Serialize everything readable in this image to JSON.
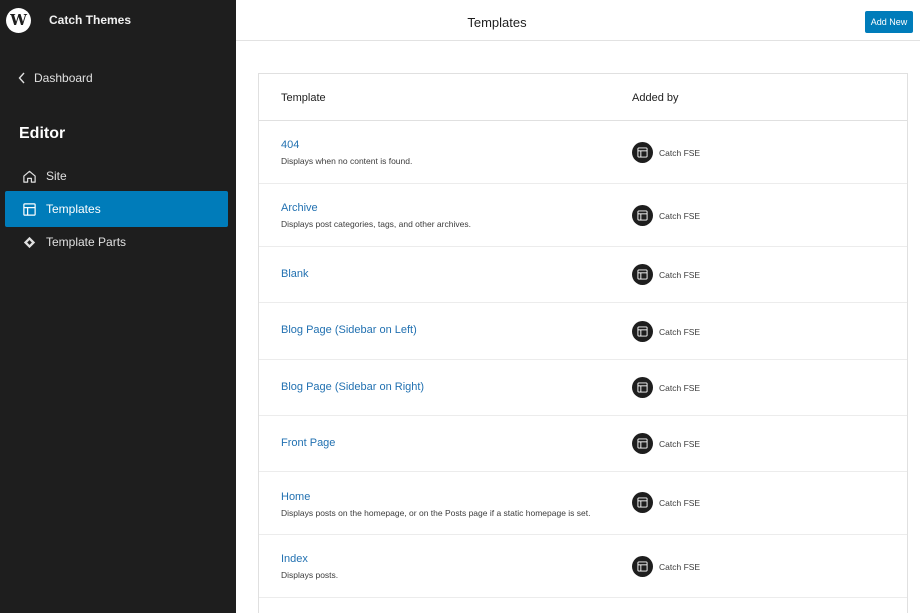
{
  "sidebar": {
    "site_name": "Catch Themes",
    "back_label": "Dashboard",
    "section_title": "Editor",
    "items": [
      {
        "label": "Site",
        "icon": "home-icon"
      },
      {
        "label": "Templates",
        "icon": "layout-icon",
        "active": true
      },
      {
        "label": "Template Parts",
        "icon": "symbol-icon"
      }
    ]
  },
  "header": {
    "title": "Templates",
    "add_new_label": "Add New"
  },
  "table": {
    "columns": [
      "Template",
      "Added by"
    ],
    "rows": [
      {
        "title": "404",
        "description": "Displays when no content is found.",
        "author": "Catch FSE"
      },
      {
        "title": "Archive",
        "description": "Displays post categories, tags, and other archives.",
        "author": "Catch FSE"
      },
      {
        "title": "Blank",
        "description": "",
        "author": "Catch FSE"
      },
      {
        "title": "Blog Page (Sidebar on Left)",
        "description": "",
        "author": "Catch FSE"
      },
      {
        "title": "Blog Page (Sidebar on Right)",
        "description": "",
        "author": "Catch FSE"
      },
      {
        "title": "Front Page",
        "description": "",
        "author": "Catch FSE"
      },
      {
        "title": "Home",
        "description": "Displays posts on the homepage, or on the Posts page if a static homepage is set.",
        "author": "Catch FSE"
      },
      {
        "title": "Index",
        "description": "Displays posts.",
        "author": "Catch FSE"
      }
    ]
  },
  "colors": {
    "sidebar_bg": "#1e1e1e",
    "accent": "#007cba",
    "link": "#2271b1"
  }
}
